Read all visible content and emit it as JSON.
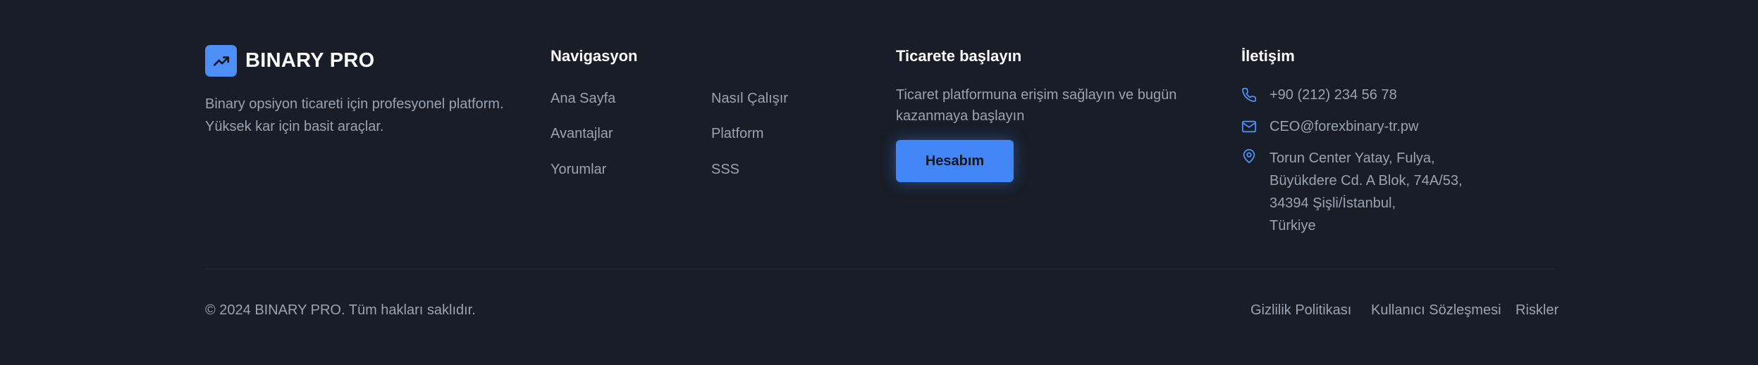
{
  "brand": {
    "name": "BINARY PRO",
    "description_lines": [
      "Binary opsiyon ticareti için profesyonel platform.",
      "Yüksek kar için basit araçlar."
    ],
    "accent_color": "#4e8ef7",
    "logo_icon": "trending-up-icon"
  },
  "navigation": {
    "title": "Navigasyon",
    "links": [
      "Ana Sayfa",
      "Nasıl Çalışır",
      "Avantajlar",
      "Platform",
      "Yorumlar",
      "SSS"
    ]
  },
  "cta": {
    "title": "Ticarete başlayın",
    "text_lines": [
      "Ticaret platformuna erişim sağlayın ve bugün",
      "kazanmaya başlayın"
    ],
    "button_label": "Hesabım",
    "button_color": "#4285f4"
  },
  "contact": {
    "title": "İletişim",
    "phone": "+90 (212) 234 56 78",
    "email": "CEO@forexbinary-tr.pw",
    "address_lines": [
      "Torun Center Yatay, Fulya,",
      "Büyükdere Cd. A Blok, 74A/53,",
      "34394 Şişli/İstanbul,",
      "Türkiye"
    ],
    "icons": [
      "phone-icon",
      "mail-icon",
      "map-pin-icon"
    ]
  },
  "bottom": {
    "copyright": "© 2024 BINARY PRO. Tüm hakları saklıdır.",
    "links": [
      "Gizlilik Politikası",
      "Kullanıcı Sözleşmesi",
      "Riskler"
    ]
  }
}
